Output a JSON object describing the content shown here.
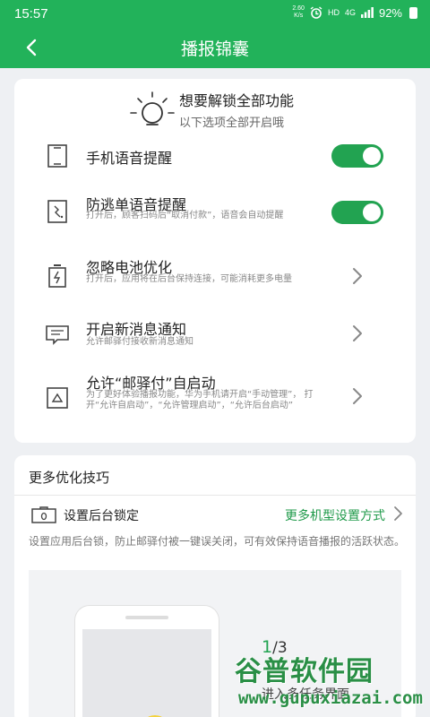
{
  "status": {
    "time": "15:57",
    "speed_top": "2.60",
    "speed_bottom": "K/s",
    "hd": "HD",
    "net": "4G",
    "battery": "92%"
  },
  "appbar": {
    "title": "播报锦囊"
  },
  "unlock": {
    "title": "想要解锁全部功能",
    "subtitle": "以下选项全部开启哦"
  },
  "settings": [
    {
      "label": "手机语音提醒",
      "desc": "",
      "control": "toggle",
      "on": true,
      "icon": "phone-icon"
    },
    {
      "label": "防逃单语音提醒",
      "desc": "打开后，顾客扫码后“取消付款”，语音会自动提醒",
      "control": "toggle",
      "on": true,
      "icon": "cancel-scan-icon"
    },
    {
      "label": "忽略电池优化",
      "desc": "打开后，应用将在后台保持连接，可能消耗更多电量",
      "control": "chevron",
      "icon": "battery-icon"
    },
    {
      "label": "开启新消息通知",
      "desc": "允许邮驿付接收新消息通知",
      "control": "chevron",
      "icon": "message-icon"
    },
    {
      "label": "允许“邮驿付”自启动",
      "desc": "为了更好体验播报功能，华为手机请开启“手动管理”， 打开“允许自启动”，“允许管理启动”，“允许后台启动”",
      "control": "chevron",
      "icon": "autostart-icon"
    }
  ],
  "tips": {
    "title": "更多优化技巧",
    "lock_label": "设置后台锁定",
    "more_link": "更多机型设置方式",
    "text": "设置应用后台锁，防止邮驿付被一键误关闭，可有效保持语音播报的活跃状态。",
    "page_current": "1",
    "page_total": "/3",
    "enter_text": "进入多任务界面"
  },
  "watermark": {
    "text": "谷普软件园",
    "url": "www.gupuxiazai.com"
  },
  "colors": {
    "primary": "#22b25a",
    "toggle_on": "#22a351",
    "link": "#1f9a4a"
  }
}
